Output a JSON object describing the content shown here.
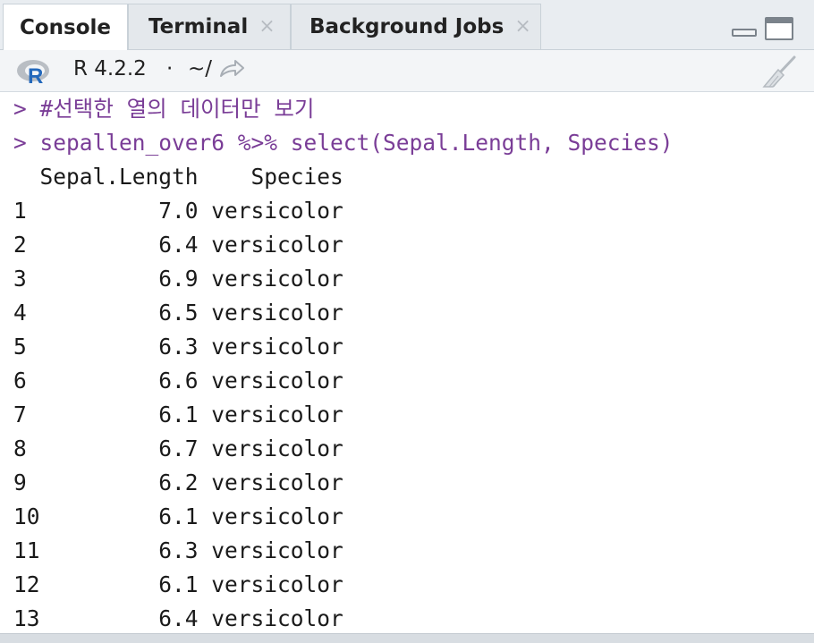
{
  "tabs": [
    {
      "label": "Console",
      "closable": false,
      "active": true
    },
    {
      "label": "Terminal",
      "closable": true,
      "active": false
    },
    {
      "label": "Background Jobs",
      "closable": true,
      "active": false
    }
  ],
  "close_glyph": "×",
  "window_controls": {
    "minimize": "minimize-icon",
    "maximize": "maximize-icon"
  },
  "infobar": {
    "r_icon": "r-logo-icon",
    "r_version": "R 4.2.2",
    "separator": "·",
    "working_dir": "~/",
    "goto_icon": "goto-directory-icon",
    "clear_icon": "broom-icon"
  },
  "console": {
    "lines": [
      {
        "type": "comment",
        "text": "> #선택한 열의 데이터만 보기"
      },
      {
        "type": "command",
        "text": "> sepallen_over6 %>% select(Sepal.Length, Species)"
      },
      {
        "type": "output",
        "text": "  Sepal.Length    Species"
      },
      {
        "type": "output",
        "text": "1          7.0 versicolor"
      },
      {
        "type": "output",
        "text": "2          6.4 versicolor"
      },
      {
        "type": "output",
        "text": "3          6.9 versicolor"
      },
      {
        "type": "output",
        "text": "4          6.5 versicolor"
      },
      {
        "type": "output",
        "text": "5          6.3 versicolor"
      },
      {
        "type": "output",
        "text": "6          6.6 versicolor"
      },
      {
        "type": "output",
        "text": "7          6.1 versicolor"
      },
      {
        "type": "output",
        "text": "8          6.7 versicolor"
      },
      {
        "type": "output",
        "text": "9          6.2 versicolor"
      },
      {
        "type": "output",
        "text": "10         6.1 versicolor"
      },
      {
        "type": "output",
        "text": "11         6.3 versicolor"
      },
      {
        "type": "output",
        "text": "12         6.1 versicolor"
      },
      {
        "type": "output",
        "text": "13         6.4 versicolor"
      }
    ]
  },
  "colors": {
    "command": "#7a3d97",
    "output": "#1a1a1a",
    "tabbar_bg": "#e9edf1",
    "infobar_bg": "#f3f5f7",
    "r_logo_blue": "#2368bb"
  }
}
